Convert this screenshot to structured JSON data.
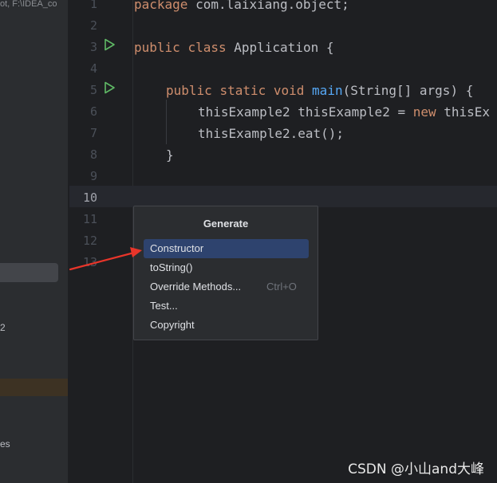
{
  "sidebar": {
    "path_text": "ot,  F:\\IDEA_co",
    "partial_2": "2",
    "partial_es": "es"
  },
  "gutter": {
    "line_numbers": [
      "1",
      "2",
      "3",
      "4",
      "5",
      "6",
      "7",
      "8",
      "9",
      "10",
      "11",
      "12",
      "13"
    ],
    "run_icon_name": "run-play-icon"
  },
  "code": {
    "l1_kw": "package",
    "l1_rest": " com.laixiang.object;",
    "l3_kw1": "public",
    "l3_kw2": "class",
    "l3_rest": " Application {",
    "l5_kw1": "public",
    "l5_kw2": "static",
    "l5_kw3": "void",
    "l5_fn": "main",
    "l5_rest": "(String[] args) {",
    "l6_a": "thisExample2 thisExample2 = ",
    "l6_kw": "new",
    "l6_b": " thisEx",
    "l7": "thisExample2.eat();",
    "l8": "}"
  },
  "popup": {
    "title": "Generate",
    "items": [
      {
        "label": "Constructor",
        "shortcut": ""
      },
      {
        "label": "toString()",
        "shortcut": ""
      },
      {
        "label": "Override Methods...",
        "shortcut": "Ctrl+O"
      },
      {
        "label": "Test...",
        "shortcut": ""
      },
      {
        "label": "Copyright",
        "shortcut": ""
      }
    ]
  },
  "watermark": "CSDN @小山and大峰",
  "colors": {
    "background": "#1e1f22",
    "keyword": "#cf8e6d",
    "function": "#56a8f5",
    "selection": "#2e436e",
    "arrow": "#e8352a",
    "run_icon": "#5fb865"
  }
}
